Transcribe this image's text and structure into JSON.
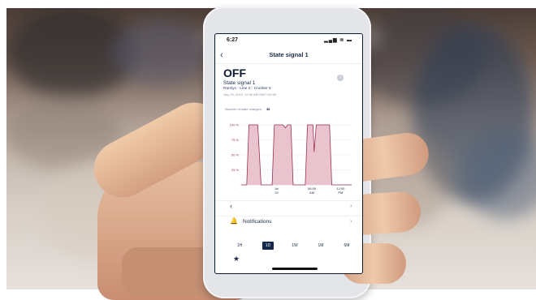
{
  "phone": {
    "status_time": "6:27",
    "status_icons": "▂▄▆ ≋ ▬",
    "nav_title": "State signal 1",
    "back_label": "‹",
    "state": "OFF",
    "signal_name": "State signal 1",
    "location": "Ramlyx - Line 2 - Crusher 5",
    "timestamp": "July 29, 2019, 12:30 AM GMT+02:00",
    "changes_label": "Number of state changes:",
    "changes_count": "38",
    "info_icon": "i",
    "rows": [
      {
        "label": "",
        "icon": "‹"
      },
      {
        "label": "Notifications",
        "icon": "bell"
      }
    ],
    "chevron": "›",
    "ranges": [
      "1H",
      "1D",
      "1W",
      "1M",
      "6M"
    ],
    "selected_range": "1D",
    "star": "★"
  },
  "chart_data": {
    "type": "area",
    "y_ticks": [
      "100 %",
      "75 %",
      "50 %",
      "25 %"
    ],
    "x_ticks": [
      "Jul\n29",
      "06:00\nAM",
      "12:00\nPM"
    ],
    "x_labels": [
      {
        "line1": "Jul",
        "line2": "29"
      },
      {
        "line1": "06:00",
        "line2": "AM"
      },
      {
        "line1": "12:00",
        "line2": "PM"
      }
    ],
    "ylim": [
      0,
      100
    ],
    "series": [
      {
        "values": [
          [
            0,
            0
          ],
          [
            5,
            0
          ],
          [
            7,
            100
          ],
          [
            15,
            100
          ],
          [
            18,
            0
          ],
          [
            28,
            0
          ],
          [
            30,
            100
          ],
          [
            38,
            100
          ],
          [
            40,
            95
          ],
          [
            42,
            100
          ],
          [
            45,
            100
          ],
          [
            47,
            0
          ],
          [
            58,
            0
          ],
          [
            60,
            100
          ],
          [
            65,
            100
          ],
          [
            66,
            55
          ],
          [
            68,
            100
          ],
          [
            80,
            100
          ],
          [
            82,
            0
          ],
          [
            100,
            0
          ]
        ]
      }
    ],
    "colors": {
      "fill": "#e9c4cf",
      "line": "#9c3050"
    }
  }
}
